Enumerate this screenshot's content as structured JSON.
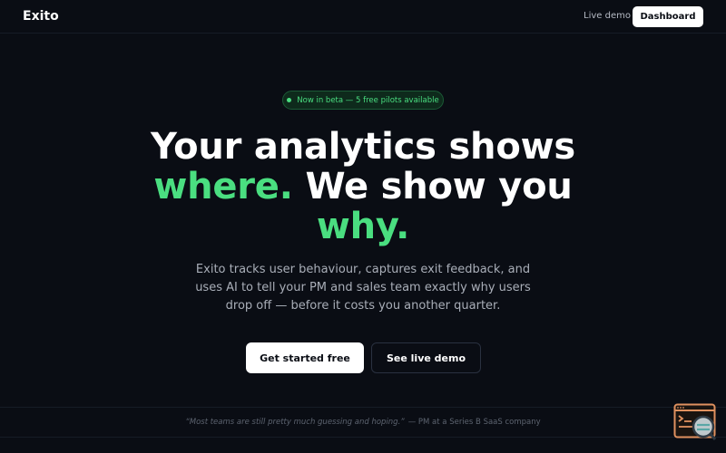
{
  "nav": {
    "logo": "Exito",
    "live_demo": "Live demo",
    "dashboard": "Dashboard"
  },
  "hero": {
    "badge": "Now in beta — 5 free pilots available",
    "headline_1": "Your analytics shows",
    "headline_accent_1": "where.",
    "headline_2": " We show you",
    "headline_accent_2": "why.",
    "subtext": "Exito tracks user behaviour, captures exit feedback, and uses AI to tell your PM and sales team exactly why users drop off — before it costs you another quarter.",
    "cta_primary": "Get started free",
    "cta_secondary": "See live demo"
  },
  "quote": {
    "text": "“Most teams are still pretty much guessing and hoping.”",
    "author": "— PM at a Series B SaaS company"
  },
  "widget": {
    "icon": "feedback-widget-icon"
  },
  "colors": {
    "background": "#0a0d14",
    "accent": "#4ade80",
    "widget_orange": "#e0915f",
    "widget_teal": "#5aa7a6"
  }
}
